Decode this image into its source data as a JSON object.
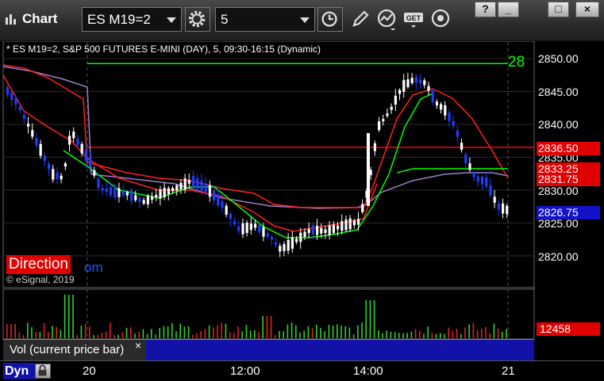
{
  "window": {
    "title": "Chart",
    "symbol": "ES M19=2",
    "interval": "5",
    "controls": [
      "?",
      "_",
      "□",
      "×"
    ]
  },
  "chart": {
    "header": "* ES M19=2, S&P 500 FUTURES E-MINI (DAY), 5, 09:30-16:15 (Dynamic)",
    "brand_logo": "Direction",
    "brand_suffix": "om",
    "copyright": "© eSignal, 2019",
    "last_price_partial": "28",
    "price_axis_labels": [
      "2850.00",
      "2845.00",
      "2840.00",
      "2835.00",
      "2830.00",
      "2825.00",
      "2820.00"
    ],
    "price_tags": [
      {
        "text": "2836.50",
        "color": "#e00000"
      },
      {
        "text": "2833.25",
        "color": "#e00000"
      },
      {
        "text": "2831.75",
        "color": "#e00000"
      },
      {
        "text": "2826.75",
        "color": "#1212c8"
      }
    ],
    "colors": {
      "up_candle": "#ffffff",
      "down_candle": "#1f3dff",
      "resistance_line": "#00ff00",
      "support_line": "#ff0000",
      "ma_green": "#00ff00",
      "ma_red": "#ff2020",
      "ma_purple": "#9a80c8"
    }
  },
  "volume": {
    "legend": "Vol (current price bar)",
    "close_label": "×",
    "value": "12458"
  },
  "time_axis": {
    "mode_label": "Dyn",
    "labels": [
      "20",
      "12:00",
      "14:00",
      "21"
    ]
  },
  "chart_data": {
    "type": "candlestick",
    "y_axis_range": [
      2815.5,
      2852.5
    ],
    "horizontal_lines": [
      {
        "price": 2849.25,
        "color": "#00ff00"
      },
      {
        "price": 2836.5,
        "color": "#ff0000"
      }
    ],
    "price_tag_values": [
      2836.5,
      2833.25,
      2831.75,
      2826.75
    ]
  }
}
